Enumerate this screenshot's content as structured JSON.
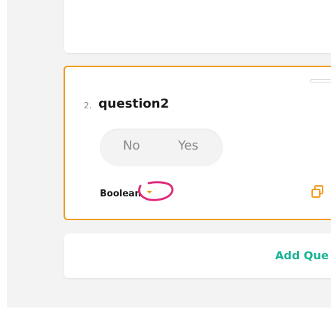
{
  "question": {
    "number": "2.",
    "title": "question2",
    "boolean_false_label": "No",
    "boolean_true_label": "Yes",
    "type_label": "Boolean"
  },
  "footer": {
    "add_question_label": "Add Que"
  },
  "colors": {
    "accent_orange": "#f29b1d",
    "accent_green": "#19b394",
    "annotation_pink": "#e0287a"
  },
  "icons": {
    "type_dropdown": "chevron-down-icon",
    "duplicate": "copy-icon"
  }
}
